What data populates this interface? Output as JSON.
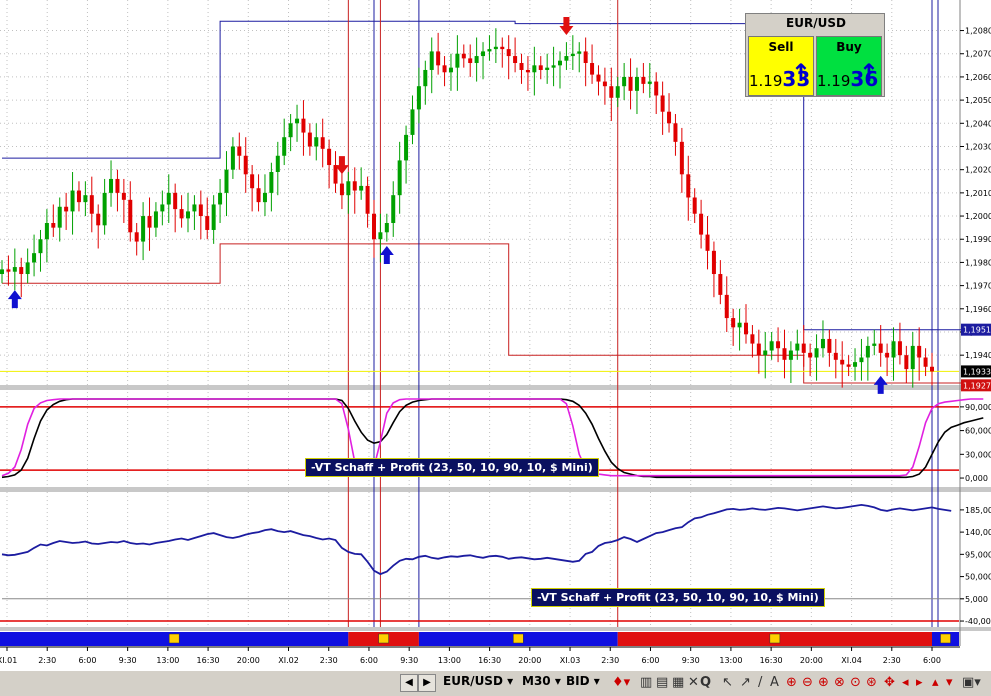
{
  "chart_data": [
    {
      "type": "candlestick",
      "symbol": "EUR/USD",
      "price_axis_labels": [
        "1,2080",
        "1,2070",
        "1,2060",
        "1,2050",
        "1,2040",
        "1,2030",
        "1,2020",
        "1,2010",
        "1,2000",
        "1,1990",
        "1,1980",
        "1,1970",
        "1,1960",
        "1,1950",
        "1,1940"
      ],
      "price_markers": {
        "upper": "1,1951",
        "current": "1,1933",
        "lower": "1,1927"
      },
      "ylim": [
        1.1928,
        1.2088
      ],
      "close_series": [
        1.1977,
        1.1976,
        1.1978,
        1.1975,
        1.198,
        1.1984,
        1.199,
        1.1997,
        1.1995,
        1.2004,
        1.2002,
        1.2011,
        1.2006,
        1.2009,
        1.2001,
        1.1996,
        1.201,
        1.2016,
        1.201,
        1.2007,
        1.1993,
        1.1989,
        1.2,
        1.1995,
        1.2002,
        1.2005,
        1.201,
        1.2003,
        1.1999,
        1.2002,
        1.2005,
        1.2,
        1.1994,
        1.2005,
        1.201,
        1.202,
        1.203,
        1.2026,
        1.2018,
        1.2012,
        1.2006,
        1.201,
        1.2019,
        1.2026,
        1.2034,
        1.204,
        1.2042,
        1.2036,
        1.203,
        1.2034,
        1.2029,
        1.2022,
        1.2014,
        1.2009,
        1.2015,
        1.2011,
        1.2013,
        1.2001,
        1.199,
        1.1993,
        1.1997,
        1.2009,
        1.2024,
        1.2035,
        1.2046,
        1.2056,
        1.2063,
        1.2071,
        1.2065,
        1.2062,
        1.2064,
        1.207,
        1.2068,
        1.2066,
        1.2069,
        1.2071,
        1.2072,
        1.2073,
        1.2072,
        1.2069,
        1.2066,
        1.2063,
        1.2062,
        1.2065,
        1.2063,
        1.2064,
        1.2065,
        1.2067,
        1.2069,
        1.207,
        1.2071,
        1.2066,
        1.2061,
        1.2058,
        1.2056,
        1.2051,
        1.2056,
        1.206,
        1.2054,
        1.206,
        1.2057,
        1.2058,
        1.2052,
        1.2045,
        1.204,
        1.2032,
        1.2018,
        1.2008,
        1.2001,
        1.1992,
        1.1985,
        1.1975,
        1.1966,
        1.1956,
        1.1952,
        1.1954,
        1.1949,
        1.1945,
        1.194,
        1.1942,
        1.1946,
        1.1943,
        1.1938,
        1.1942,
        1.1945,
        1.1941,
        1.1939,
        1.1943,
        1.1947,
        1.1941,
        1.1938,
        1.1936,
        1.1935,
        1.1937,
        1.1939,
        1.1944,
        1.1945,
        1.1941,
        1.1939,
        1.1946,
        1.194,
        1.1934,
        1.1944,
        1.1939,
        1.1935,
        1.1933
      ],
      "overlay_lines": [
        {
          "name": "upper channel",
          "color": "#1c1ca0"
        },
        {
          "name": "lower channel",
          "color": "#c82020"
        }
      ],
      "signals": [
        {
          "direction": "buy",
          "bar": 2
        },
        {
          "direction": "sell",
          "bar": 53
        },
        {
          "direction": "buy",
          "bar": 60
        },
        {
          "direction": "sell",
          "bar": 88
        },
        {
          "direction": "buy",
          "bar": 137
        }
      ]
    },
    {
      "type": "line",
      "indicator": "-VT Schaff + Profit (23, 50, 10, 90, 10, $ Mini)",
      "y_axis_labels": [
        "90,000",
        "60,000",
        "30,000",
        "0,000"
      ],
      "ylim": [
        -5,
        105
      ],
      "levels": [
        90,
        10
      ],
      "series": [
        {
          "color": "#000000",
          "values": [
            1,
            2,
            4,
            10,
            25,
            50,
            72,
            86,
            93,
            97,
            99,
            100,
            100,
            100,
            100,
            100,
            100,
            100,
            100,
            100,
            100,
            100,
            100,
            100,
            100,
            100,
            100,
            100,
            100,
            100,
            100,
            100,
            100,
            100,
            100,
            100,
            100,
            100,
            100,
            100,
            100,
            100,
            100,
            100,
            100,
            100,
            100,
            100,
            100,
            100,
            100,
            100,
            100,
            98,
            88,
            72,
            58,
            48,
            44,
            46,
            55,
            70,
            84,
            92,
            96,
            98,
            99,
            100,
            100,
            100,
            100,
            100,
            100,
            100,
            100,
            100,
            100,
            100,
            100,
            100,
            100,
            100,
            100,
            100,
            100,
            100,
            100,
            100,
            99,
            97,
            92,
            82,
            68,
            50,
            34,
            20,
            12,
            7,
            5,
            3,
            2,
            2,
            1,
            1,
            1,
            1,
            1,
            1,
            1,
            1,
            1,
            1,
            1,
            1,
            1,
            1,
            1,
            1,
            1,
            1,
            1,
            1,
            1,
            1,
            1,
            1,
            1,
            1,
            1,
            1,
            1,
            1,
            1,
            1,
            1,
            1,
            1,
            1,
            1,
            1,
            1,
            1,
            2,
            5,
            14,
            30,
            46,
            58,
            64,
            67,
            70,
            72,
            74,
            76
          ]
        },
        {
          "color": "#e020e0",
          "values": [
            3,
            6,
            14,
            36,
            68,
            88,
            95,
            98,
            99,
            100,
            100,
            100,
            100,
            100,
            100,
            100,
            100,
            100,
            100,
            100,
            100,
            100,
            100,
            100,
            100,
            100,
            100,
            100,
            100,
            100,
            100,
            100,
            100,
            100,
            100,
            100,
            100,
            100,
            100,
            100,
            100,
            100,
            100,
            100,
            100,
            100,
            100,
            100,
            100,
            100,
            100,
            100,
            100,
            94,
            62,
            20,
            8,
            6,
            14,
            46,
            82,
            95,
            99,
            100,
            100,
            100,
            100,
            100,
            100,
            100,
            100,
            100,
            100,
            100,
            100,
            100,
            100,
            100,
            100,
            100,
            100,
            100,
            100,
            100,
            100,
            100,
            100,
            100,
            94,
            66,
            30,
            12,
            7,
            5,
            4,
            3,
            3,
            3,
            3,
            3,
            3,
            3,
            3,
            3,
            3,
            3,
            3,
            3,
            3,
            3,
            3,
            3,
            3,
            3,
            3,
            3,
            3,
            3,
            3,
            3,
            3,
            3,
            3,
            3,
            3,
            3,
            3,
            3,
            3,
            3,
            3,
            3,
            3,
            3,
            3,
            3,
            3,
            3,
            3,
            3,
            3,
            4,
            14,
            40,
            70,
            88,
            94,
            96,
            97,
            98,
            99,
            100,
            100,
            100
          ]
        }
      ]
    },
    {
      "type": "line",
      "indicator": "-VT Schaff + Profit (23, 50, 10, 90, 10, $ Mini)",
      "y_axis_labels": [
        "185,000",
        "140,000",
        "95,000",
        "50,000",
        "5,000",
        "-40,000"
      ],
      "ylim": [
        -48000,
        205000
      ],
      "series": [
        {
          "color": "#1c1ca0",
          "values": [
            95000,
            93000,
            94000,
            97000,
            100000,
            108000,
            115000,
            113000,
            118000,
            122000,
            120000,
            118000,
            119000,
            121000,
            117000,
            116000,
            118000,
            120000,
            119000,
            122000,
            118000,
            116000,
            117000,
            115000,
            118000,
            120000,
            122000,
            125000,
            127000,
            124000,
            128000,
            132000,
            136000,
            138000,
            134000,
            130000,
            128000,
            131000,
            135000,
            138000,
            140000,
            144000,
            146000,
            142000,
            140000,
            142000,
            138000,
            134000,
            132000,
            128000,
            125000,
            127000,
            124000,
            108000,
            100000,
            96000,
            95000,
            80000,
            62000,
            55000,
            60000,
            72000,
            82000,
            86000,
            85000,
            90000,
            92000,
            88000,
            86000,
            89000,
            91000,
            90000,
            92000,
            93000,
            90000,
            88000,
            91000,
            92000,
            90000,
            86000,
            88000,
            89000,
            87000,
            85000,
            86000,
            88000,
            86000,
            84000,
            82000,
            80000,
            82000,
            96000,
            100000,
            112000,
            118000,
            120000,
            124000,
            130000,
            126000,
            120000,
            126000,
            132000,
            138000,
            140000,
            144000,
            148000,
            150000,
            160000,
            168000,
            170000,
            175000,
            178000,
            182000,
            186000,
            187000,
            185000,
            186000,
            188000,
            186000,
            185000,
            187000,
            189000,
            188000,
            186000,
            184000,
            186000,
            188000,
            190000,
            192000,
            190000,
            188000,
            189000,
            191000,
            193000,
            195000,
            193000,
            190000,
            185000,
            183000,
            186000,
            188000,
            186000,
            184000,
            186000,
            188000,
            190000,
            187000,
            185000,
            183000
          ]
        },
        {
          "color": "#888888",
          "values": [
            5000,
            5000,
            5000,
            5000,
            5000,
            5000,
            5000,
            5000,
            5000,
            5000,
            5000,
            5000,
            5000,
            5000,
            5000,
            5000,
            5000,
            5000,
            5000,
            5000,
            5000,
            5000,
            5000,
            5000,
            5000,
            5000,
            5000,
            5000,
            5000,
            5000,
            5000,
            5000,
            5000,
            5000,
            5000,
            5000,
            5000,
            5000,
            5000,
            5000,
            5000,
            5000,
            5000,
            5000,
            5000,
            5000,
            5000,
            5000,
            5000,
            5000,
            5000,
            5000,
            5000,
            5000,
            5000,
            5000,
            5000,
            5000,
            5000,
            5000,
            5000,
            5000,
            5000,
            5000,
            5000,
            5000,
            5000,
            5000,
            5000,
            5000,
            5000,
            5000,
            5000,
            5000,
            5000,
            5000,
            5000,
            5000,
            5000,
            5000,
            5000,
            5000,
            5000,
            5000,
            5000,
            5000,
            5000,
            5000,
            5000,
            5000,
            5000,
            5000,
            5000,
            5000,
            5000,
            5000,
            5000,
            5000,
            5000,
            5000,
            5000,
            5000,
            5000,
            5000,
            5000,
            5000,
            5000,
            5000,
            5000,
            5000,
            5000,
            5000,
            5000,
            5000,
            5000,
            5000,
            5000,
            5000,
            5000,
            5000,
            5000,
            5000,
            5000,
            5000,
            5000,
            5000,
            5000,
            5000,
            5000,
            5000,
            5000,
            5000,
            5000,
            5000,
            5000,
            5000,
            5000,
            5000,
            5000,
            5000,
            5000,
            5000,
            5000,
            5000,
            5000,
            5000,
            5000,
            5000,
            5000,
            5000,
            5000
          ]
        }
      ],
      "levels": [
        -40000
      ]
    }
  ],
  "time_axis_labels": [
    "XI.01",
    "2:30",
    "6:00",
    "9:30",
    "13:00",
    "16:30",
    "20:00",
    "XI.02",
    "2:30",
    "6:00",
    "9:30",
    "13:00",
    "16:30",
    "20:00",
    "XI.03",
    "2:30",
    "6:00",
    "9:30",
    "13:00",
    "16:30",
    "20:00",
    "XI.04",
    "2:30",
    "6:00"
  ],
  "quote_panel": {
    "symbol": "EUR/USD",
    "sell_label": "Sell",
    "buy_label": "Buy",
    "sell_price_prefix": "1.19",
    "sell_price_big": "33",
    "buy_price_prefix": "1.19",
    "buy_price_big": "36",
    "sell_color": "#ffff00",
    "buy_color": "#00e040"
  },
  "indicator_labels": {
    "top": "-VT Schaff + Profit (23, 50, 10, 90, 10, $ Mini)",
    "bottom": "-VT Schaff + Profit (23, 50, 10, 90, 10, $ Mini)"
  },
  "signal_bar": {
    "segments": [
      {
        "color": "#1010e0",
        "icon": "bull-icon"
      },
      {
        "color": "#e01010",
        "icon": "bear-icon"
      },
      {
        "color": "#1010e0",
        "icon": "bull-icon"
      },
      {
        "color": "#e01010",
        "icon": "bear-icon"
      },
      {
        "color": "#1010e0",
        "icon": "bull-icon"
      }
    ]
  },
  "toolbar": {
    "symbol": "EUR/USD",
    "interval": "M30",
    "price_type": "BID",
    "icons": [
      "play-icon",
      "chart-type-icon",
      "bar-icon",
      "crosshair-icon",
      "search-icon",
      "pointer-icon",
      "draw-icon",
      "zoom-in-icon",
      "zoom-out-icon",
      "scroll-icon",
      "settings-icon"
    ]
  }
}
